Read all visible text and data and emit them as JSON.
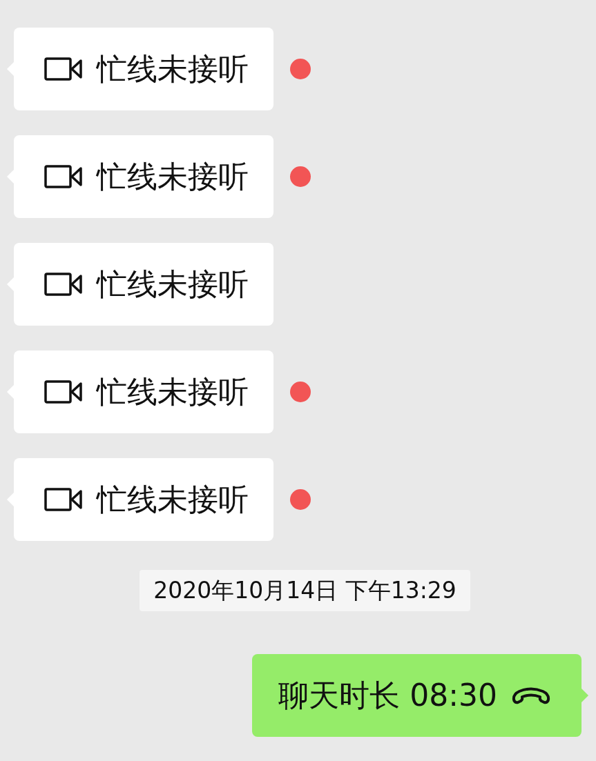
{
  "messages": [
    {
      "kind": "video_call",
      "text": "忙线未接听",
      "unread": true
    },
    {
      "kind": "video_call",
      "text": "忙线未接听",
      "unread": true
    },
    {
      "kind": "video_call",
      "text": "忙线未接听",
      "unread": false
    },
    {
      "kind": "video_call",
      "text": "忙线未接听",
      "unread": true
    },
    {
      "kind": "video_call",
      "text": "忙线未接听",
      "unread": true
    },
    {
      "kind": "timestamp",
      "text": "2020年10月14日 下午13:29"
    },
    {
      "kind": "voice_call",
      "text": "聊天时长 08:30"
    }
  ]
}
